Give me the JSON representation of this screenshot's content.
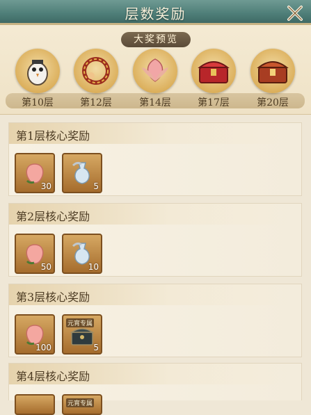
{
  "header": {
    "title": "层数奖励"
  },
  "preview": {
    "title": "大奖预览",
    "prizes": [
      {
        "label": "第10层"
      },
      {
        "label": "第12层"
      },
      {
        "label": "第14层"
      },
      {
        "label": "第17层"
      },
      {
        "label": "第20层"
      }
    ]
  },
  "sections": [
    {
      "title": "第1层核心奖励",
      "items": [
        {
          "count": "30"
        },
        {
          "count": "5"
        }
      ]
    },
    {
      "title": "第2层核心奖励",
      "items": [
        {
          "count": "50"
        },
        {
          "count": "10"
        }
      ]
    },
    {
      "title": "第3层核心奖励",
      "items": [
        {
          "count": "100"
        },
        {
          "count": "5",
          "tag": "元宵专属"
        }
      ]
    },
    {
      "title": "第4层核心奖励",
      "items": [
        {
          "count": ""
        },
        {
          "count": "",
          "tag": "元宵专属"
        }
      ]
    }
  ],
  "colors": {
    "accent": "#4e7e78",
    "panel": "#efe7d6",
    "item_frame": "#a56c2d"
  }
}
